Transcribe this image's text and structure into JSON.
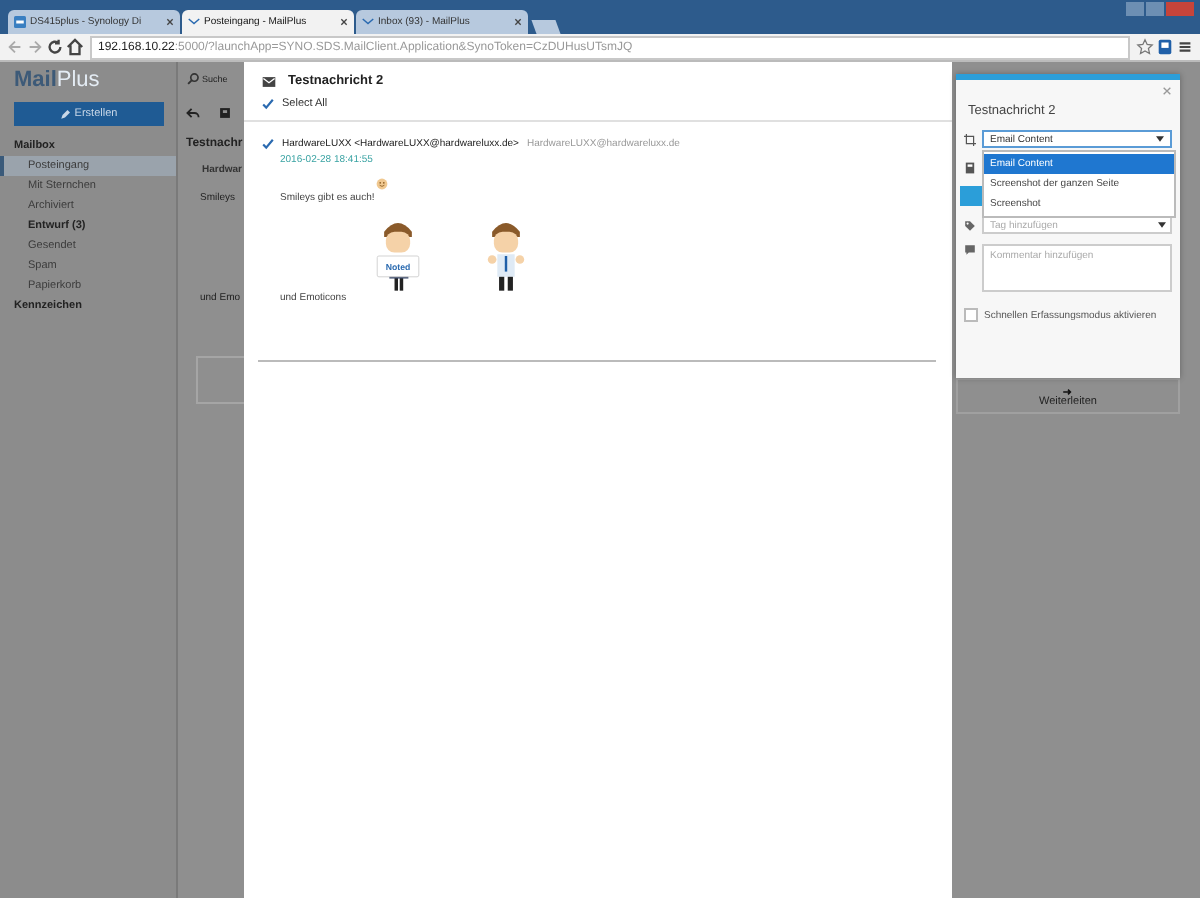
{
  "browser": {
    "tabs": [
      {
        "label": "DS415plus - Synology Di",
        "selected": false,
        "kind": "synology"
      },
      {
        "label": "Posteingang - MailPlus",
        "selected": true,
        "kind": "mail"
      },
      {
        "label": "Inbox (93) - MailPlus",
        "selected": false,
        "kind": "mail"
      }
    ],
    "address": {
      "host": "192.168.10.22",
      "path": ":5000/?launchApp=SYNO.SDS.MailClient.Application&SynoToken=CzDUHusUTsmJQ"
    }
  },
  "sidebar": {
    "logo_a": "Mail",
    "logo_b": "Plus",
    "compose": "Erstellen",
    "section": "Mailbox",
    "items": [
      {
        "label": "Posteingang",
        "selected": true,
        "bold": false
      },
      {
        "label": "Mit Sternchen",
        "selected": false,
        "bold": false
      },
      {
        "label": "Archiviert",
        "selected": false,
        "bold": false
      },
      {
        "label": "Entwurf (3)",
        "selected": false,
        "bold": true
      },
      {
        "label": "Gesendet",
        "selected": false,
        "bold": false
      },
      {
        "label": "Spam",
        "selected": false,
        "bold": false
      },
      {
        "label": "Papierkorb",
        "selected": false,
        "bold": false
      }
    ],
    "section2": "Kennzeichen"
  },
  "mail_pane": {
    "search_placeholder": "Suche",
    "subject": "Testnachr",
    "sender": "Hardwar",
    "line_1": "Smileys",
    "line_2": "und Emo",
    "forward": "Weiterleiten"
  },
  "modal": {
    "title": "Testnachricht 2",
    "select_all": {
      "label": "Select All",
      "checked": true
    },
    "message": {
      "checked": true,
      "from": "HardwareLUXX <HardwareLUXX@hardwareluxx.de>",
      "to": "HardwareLUXX@hardwareluxx.de",
      "date": "2016-02-28 18:41:55",
      "line_1": "Smileys gibt es auch!",
      "sign_text": "Noted",
      "line_2": "und Emoticons"
    }
  },
  "clipper": {
    "title": "Testnachricht 2",
    "mode": {
      "value": "Email Content",
      "expanded": true,
      "options": [
        {
          "label": "Email Content",
          "selected": true
        },
        {
          "label": "Screenshot der ganzen Seite",
          "selected": false
        },
        {
          "label": "Screenshot",
          "selected": false
        }
      ]
    },
    "tag_placeholder": "Tag hinzufügen",
    "comment_placeholder": "Kommentar hinzufügen",
    "quick_mode": {
      "label": "Schnellen Erfassungsmodus aktivieren",
      "checked": false
    }
  }
}
